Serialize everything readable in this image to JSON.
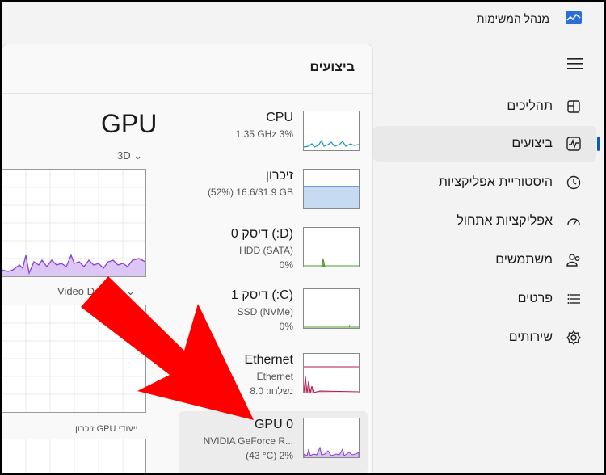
{
  "app": {
    "title": "מנהל המשימות"
  },
  "nav": {
    "items": [
      {
        "label": "תהליכים",
        "icon": "processes-icon"
      },
      {
        "label": "ביצועים",
        "icon": "performance-icon",
        "active": true
      },
      {
        "label": "היסטוריית אפליקציות",
        "icon": "history-icon"
      },
      {
        "label": "אפליקציות אתחול",
        "icon": "startup-icon"
      },
      {
        "label": "משתמשים",
        "icon": "users-icon"
      },
      {
        "label": "פרטים",
        "icon": "details-icon"
      },
      {
        "label": "שירותים",
        "icon": "services-icon"
      }
    ]
  },
  "panel": {
    "title": "ביצועים"
  },
  "devices": [
    {
      "name": "CPU",
      "line1": "1.35 GHz  3%"
    },
    {
      "name": "זיכרון",
      "line1": "(52%) 16.6/31.9 GB"
    },
    {
      "name": "דיסק 0 (:D)",
      "line1": "HDD (SATA)",
      "line2": "0%"
    },
    {
      "name": "דיסק 1 (:C)",
      "line1": "SSD (NVMe)",
      "line2": "0%"
    },
    {
      "name": "Ethernet",
      "line1": "Ethernet",
      "line2": "נשלחו: 8.0"
    },
    {
      "name": "GPU 0",
      "line1": "NVIDIA GeForce R...",
      "line2": "(43 °C) 2%",
      "selected": true
    }
  ],
  "detail": {
    "title": "GPU",
    "engine1": "3D",
    "engine2": "Video Decode",
    "dedicated_memory_label": "זיכרון GPU ייעודי"
  },
  "colors": {
    "accent": "#0a5cc2",
    "cpu": "#1b93b8",
    "memory": "#5a8ed0",
    "disk": "#4f9a2e",
    "ethernet": "#b3174d",
    "gpu": "#8a3fd6",
    "arrow": "#ff0000"
  }
}
